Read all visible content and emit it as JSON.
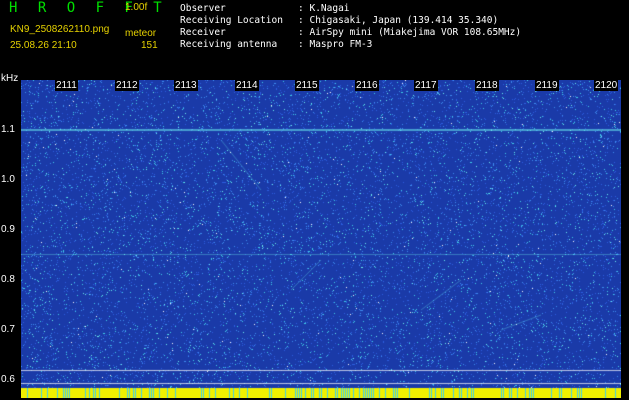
{
  "header": {
    "app_name": "H R O F F T",
    "version": "1.00f",
    "filename": "KN9_2508262110.png",
    "mode": "meteor",
    "datetime": "25.08.26 21:10",
    "count": "151",
    "text_color": "#e6d200",
    "title_color": "#00e000"
  },
  "info": [
    {
      "key": "Observer",
      "sep": ":",
      "value": "K.Nagai"
    },
    {
      "key": "Receiving Location",
      "sep": ":",
      "value": "Chigasaki, Japan (139.414 35.340)"
    },
    {
      "key": "Receiver",
      "sep": ":",
      "value": "AirSpy mini (Miakejima VOR 108.65MHz)"
    },
    {
      "key": "Receiving antenna",
      "sep": ":",
      "value": "Maspro FM-3"
    }
  ],
  "spectrogram": {
    "y_unit": "kHz",
    "y_ticks": [
      "1.1",
      "1.0",
      "0.9",
      "0.8",
      "0.7",
      "0.6"
    ],
    "x_ticks": [
      "2111",
      "2112",
      "2113",
      "2114",
      "2115",
      "2116",
      "2117",
      "2118",
      "2119",
      "2120"
    ],
    "background_color": "#1a3aa8",
    "noise_colors": [
      "#2c5ee0",
      "#3f8cf0",
      "#40d0e8",
      "#6cf0f0",
      "#ffffff"
    ],
    "bottom_strip_color": "#f0f000"
  }
}
